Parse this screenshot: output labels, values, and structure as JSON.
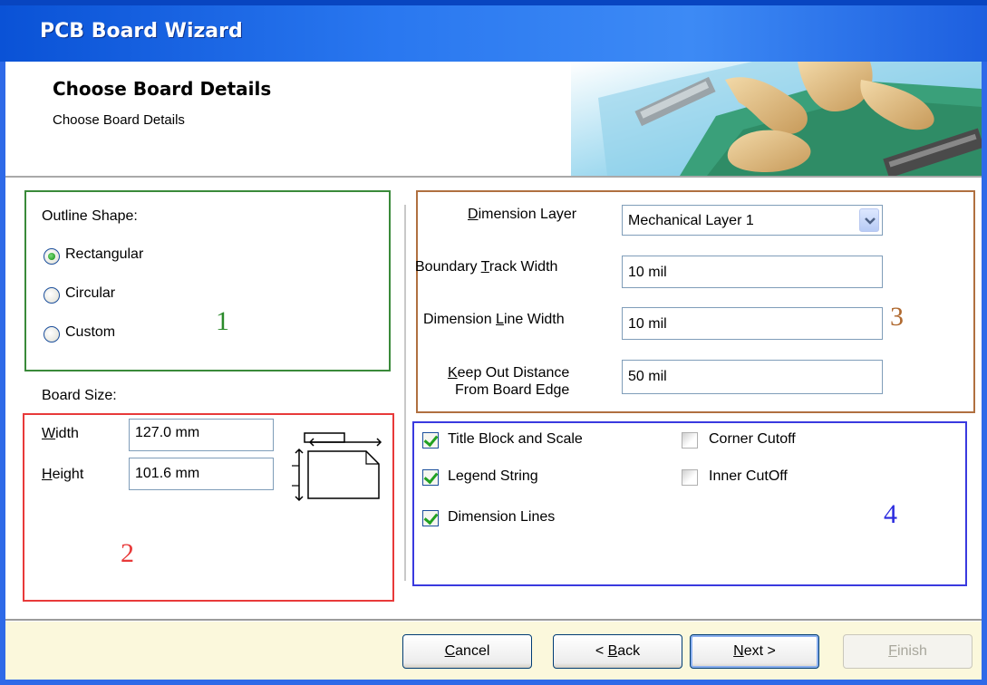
{
  "window": {
    "title": "PCB Board Wizard"
  },
  "header": {
    "title": "Choose Board Details",
    "subtitle": "Choose Board Details"
  },
  "outline": {
    "label": "Outline Shape:",
    "options": [
      {
        "label": "Rectangular",
        "selected": true
      },
      {
        "label": "Circular",
        "selected": false
      },
      {
        "label": "Custom",
        "selected": false
      }
    ],
    "annotation": "1"
  },
  "board_size": {
    "label": "Board Size:",
    "width_label_accel": "W",
    "width_label_rest": "idth",
    "width_value": "127.0 mm",
    "height_label_accel": "H",
    "height_label_rest": "eight",
    "height_value": "101.6 mm",
    "annotation": "2"
  },
  "dimensions": {
    "dimension_layer_label_accel": "D",
    "dimension_layer_label_rest": "imension Layer",
    "dimension_layer_value": "Mechanical Layer 1",
    "boundary_label_pre": "Boundary ",
    "boundary_label_accel": "T",
    "boundary_label_post": "rack Width",
    "boundary_value": "10 mil",
    "dimline_label_pre": "Dimension ",
    "dimline_label_accel": "L",
    "dimline_label_post": "ine Width",
    "dimline_value": "10 mil",
    "keepout_label_accel": "K",
    "keepout_label_rest": "eep Out Distance",
    "keepout_label_line2": "From Board Edge",
    "keepout_value": "50 mil",
    "annotation": "3"
  },
  "options": {
    "title_block": {
      "label": "Title Block and Scale",
      "checked": true
    },
    "legend": {
      "label": "Legend String",
      "checked": true
    },
    "dimension_lines": {
      "label": "Dimension Lines",
      "checked": true
    },
    "corner_cutoff": {
      "label": "Corner Cutoff",
      "checked": false
    },
    "inner_cutoff": {
      "label": "Inner CutOff",
      "checked": false
    },
    "annotation": "4"
  },
  "buttons": {
    "cancel_accel": "C",
    "cancel_rest": "ancel",
    "back_pre": "< ",
    "back_accel": "B",
    "back_rest": "ack",
    "next_accel": "N",
    "next_rest": "ext >",
    "finish_accel": "F",
    "finish_rest": "inish"
  },
  "colors": {
    "titlebar": "#2a78f0",
    "annotation_1": "#2a8a2a",
    "annotation_2": "#e83a3a",
    "annotation_3": "#b06a30",
    "annotation_4": "#2a2adf",
    "footer_bg": "#fbf8dc"
  }
}
